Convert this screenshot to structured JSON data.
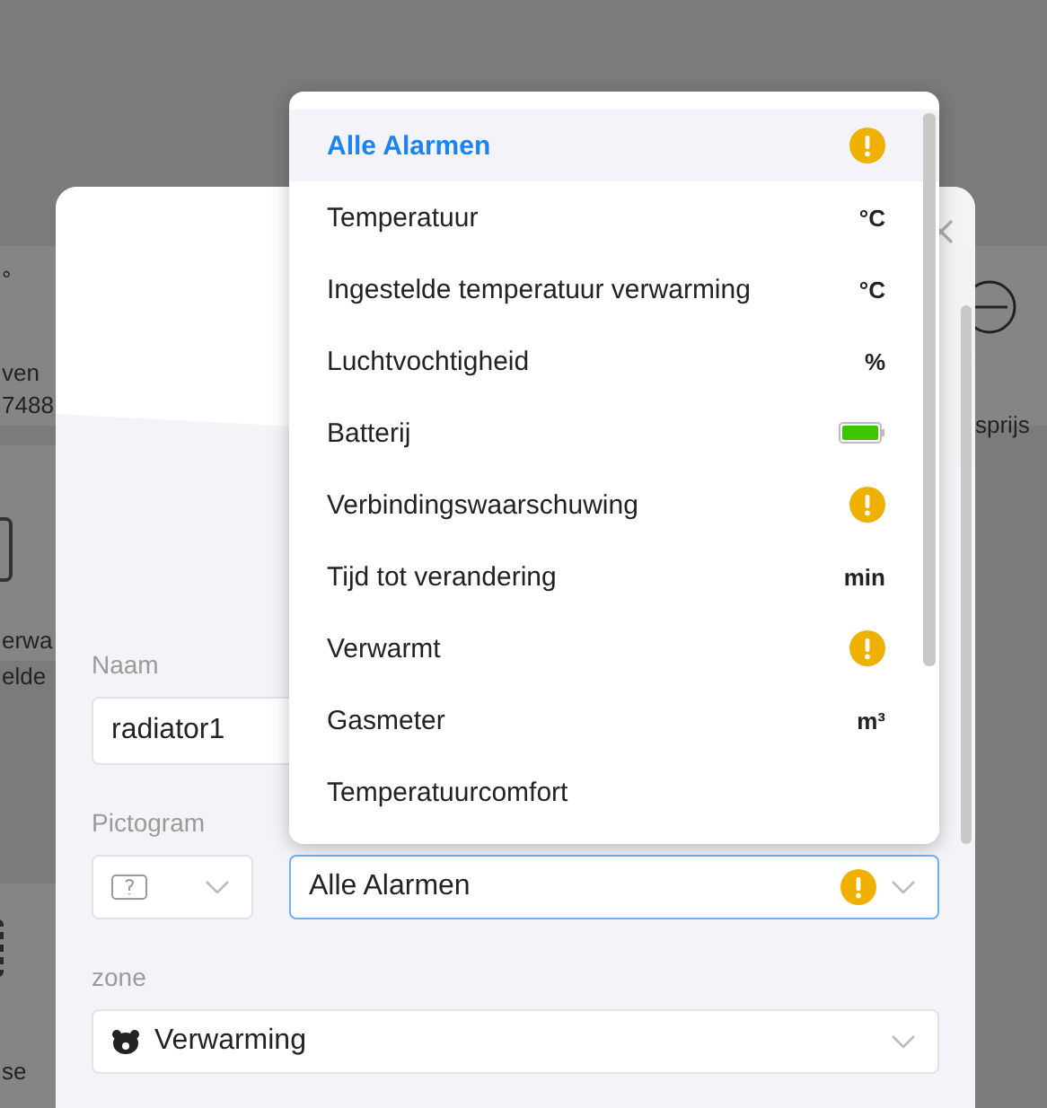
{
  "background": {
    "left_cards": [
      {
        "lines": [
          "°",
          "ven",
          "7488"
        ]
      },
      {
        "lines": [
          "erwa",
          "elde"
        ]
      },
      {
        "lines": [
          "se"
        ]
      }
    ],
    "right_card": {
      "lines": [
        "sprijs"
      ]
    }
  },
  "dialog": {
    "fields": [
      {
        "kind": "text",
        "label": "Naam",
        "value": "radiator1"
      },
      {
        "kind": "pair",
        "label": "Pictogram",
        "value": "Alle Alarmen",
        "open": true
      },
      {
        "kind": "zone",
        "label": "zone",
        "value": "Verwarming"
      }
    ]
  },
  "dropdown": {
    "options": [
      {
        "label": "Alle Alarmen",
        "kind": "warning",
        "selected": true
      },
      {
        "label": "Temperatuur",
        "kind": "unit",
        "unit": "°C",
        "selected": false
      },
      {
        "label": "Ingestelde temperatuur verwarming",
        "kind": "unit",
        "unit": "°C",
        "selected": false
      },
      {
        "label": "Luchtvochtigheid",
        "kind": "unit",
        "unit": "%",
        "selected": false
      },
      {
        "label": "Batterij",
        "kind": "battery",
        "selected": false
      },
      {
        "label": "Verbindingswaarschuwing",
        "kind": "warning",
        "selected": false
      },
      {
        "label": "Tijd tot verandering",
        "kind": "unit",
        "unit": "min",
        "selected": false
      },
      {
        "label": "Verwarmt",
        "kind": "warning",
        "selected": false
      },
      {
        "label": "Gasmeter",
        "kind": "unit",
        "unit": "m³",
        "selected": false
      },
      {
        "label": "Temperatuurcomfort",
        "kind": "plain",
        "selected": false
      }
    ]
  }
}
